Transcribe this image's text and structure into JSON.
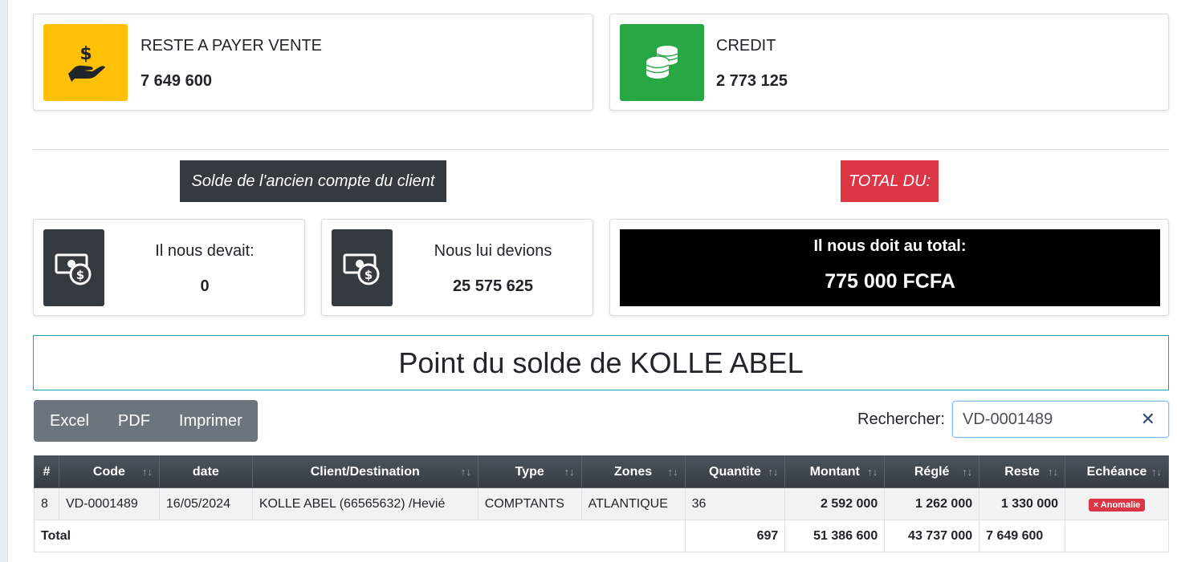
{
  "top_cards": [
    {
      "label": "RESTE A PAYER VENTE",
      "value": "7 649 600",
      "icon": "hand-dollar-icon",
      "color": "#ffc107"
    },
    {
      "label": "CREDIT",
      "value": "2 773 125",
      "icon": "coins-icon",
      "color": "#28a745"
    }
  ],
  "tags": {
    "ancien_compte": "Solde de l'ancien compte du client",
    "total_du": "TOTAL DU:"
  },
  "balance_cards": [
    {
      "label": "Il nous devait:",
      "value": "0",
      "icon": "money-bill-icon"
    },
    {
      "label": "Nous lui devions",
      "value": "25 575 625",
      "icon": "money-bill-icon"
    }
  ],
  "total_card": {
    "label": "Il nous doit au total:",
    "value": "775 000 FCFA"
  },
  "page_title": "Point du solde de KOLLE ABEL",
  "export_buttons": [
    "Excel",
    "PDF",
    "Imprimer"
  ],
  "search": {
    "label": "Rechercher:",
    "value": "VD-0001489",
    "clear_icon": "close-icon"
  },
  "table": {
    "headers": [
      "#",
      "Code",
      "date",
      "Client/Destination",
      "Type",
      "Zones",
      "Quantite",
      "Montant",
      "Réglé",
      "Reste",
      "Echéance"
    ],
    "rows": [
      {
        "num": "8",
        "code": "VD-0001489",
        "date": "16/05/2024",
        "client": "KOLLE ABEL (66565632) /Hevié",
        "type": "COMPTANTS",
        "zone": "ATLANTIQUE",
        "quantite": "36",
        "montant": "2 592 000",
        "regle": "1 262 000",
        "reste": "1 330 000",
        "echeance": "× Anomalie"
      }
    ],
    "footer": {
      "label": "Total",
      "quantite": "697",
      "montant": "51 386 600",
      "regle": "43 737 000",
      "reste": "7 649 600"
    }
  },
  "colors": {
    "warning": "#ffc107",
    "success": "#28a745",
    "danger": "#dc3545",
    "dark": "#343a40",
    "secondary": "#6c757d",
    "info": "#17a2b8"
  }
}
